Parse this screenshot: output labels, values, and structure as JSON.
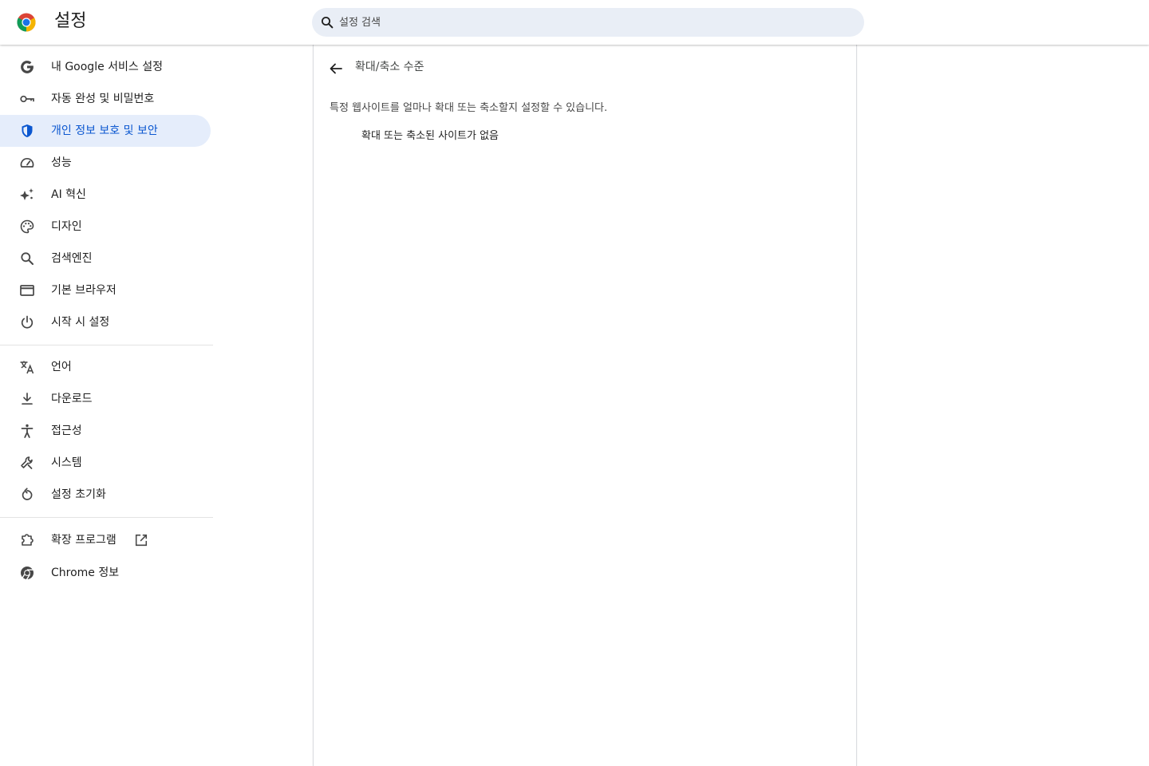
{
  "header": {
    "app_title": "설정",
    "search": {
      "placeholder": "설정 검색",
      "value": ""
    }
  },
  "sidebar": {
    "items": [
      {
        "label": "내 Google 서비스 설정",
        "icon": "google-g-icon"
      },
      {
        "label": "자동 완성 및 비밀번호",
        "icon": "key-icon"
      },
      {
        "label": "개인 정보 보호 및 보안",
        "icon": "shield-icon",
        "active": true
      },
      {
        "label": "성능",
        "icon": "speedometer-icon"
      },
      {
        "label": "AI 혁신",
        "icon": "sparkle-icon"
      },
      {
        "label": "디자인",
        "icon": "palette-icon"
      },
      {
        "label": "검색엔진",
        "icon": "search-icon"
      },
      {
        "label": "기본 브라우저",
        "icon": "browser-window-icon"
      },
      {
        "label": "시작 시 설정",
        "icon": "power-icon"
      },
      {
        "label": "언어",
        "icon": "translate-icon"
      },
      {
        "label": "다운로드",
        "icon": "download-icon"
      },
      {
        "label": "접근성",
        "icon": "accessibility-icon"
      },
      {
        "label": "시스템",
        "icon": "wrench-icon"
      },
      {
        "label": "설정 초기화",
        "icon": "reset-icon"
      },
      {
        "label": "확장 프로그램",
        "icon": "puzzle-icon",
        "external": true
      },
      {
        "label": "Chrome 정보",
        "icon": "chrome-icon"
      }
    ]
  },
  "main": {
    "title": "확대/축소 수준",
    "description": "특정 웹사이트를 얼마나 확대 또는 축소할지 설정할 수 있습니다.",
    "empty_text": "확대 또는 축소된 사이트가 없음"
  },
  "colors": {
    "accent": "#0b57d0",
    "active_bg": "#e5edfb",
    "search_bg": "#e9eef6",
    "icon": "#474747"
  }
}
